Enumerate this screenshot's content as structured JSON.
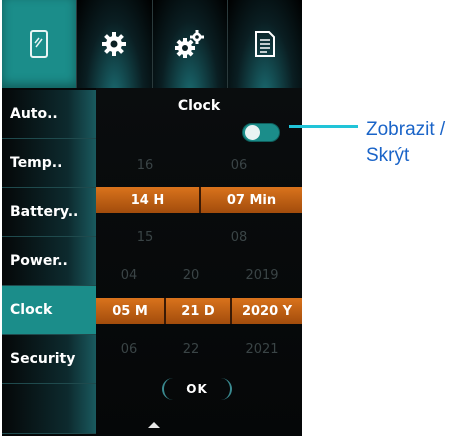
{
  "tabs": [
    {
      "name": "device",
      "icon": "phone-icon"
    },
    {
      "name": "settings",
      "icon": "gear-icon"
    },
    {
      "name": "advanced",
      "icon": "gears-icon"
    },
    {
      "name": "log",
      "icon": "document-icon"
    }
  ],
  "sidebar": {
    "items": [
      {
        "label": "Auto.."
      },
      {
        "label": "Temp.."
      },
      {
        "label": "Battery.."
      },
      {
        "label": "Power.."
      },
      {
        "label": "Clock"
      },
      {
        "label": "Security"
      }
    ],
    "active": "Clock"
  },
  "clock": {
    "title": "Clock",
    "toggle_on": true,
    "time": {
      "hour_prev": "16",
      "minute_prev": "06",
      "hour": "14 H",
      "minute": "07 Min",
      "hour_next": "15",
      "minute_next": "08"
    },
    "date": {
      "month_prev": "04",
      "day_prev": "20",
      "year_prev": "2019",
      "month": "05 M",
      "day": "21 D",
      "year": "2020 Y",
      "month_next": "06",
      "day_next": "22",
      "year_next": "2021"
    },
    "ok_label": "OK"
  },
  "callout": {
    "line1": "Zobrazit /",
    "line2": "Skrýt"
  },
  "colors": {
    "accent_teal": "#1b8d8a",
    "highlight_orange": "#d9731c",
    "callout_line": "#21c4d8",
    "callout_text": "#1a64c8"
  }
}
